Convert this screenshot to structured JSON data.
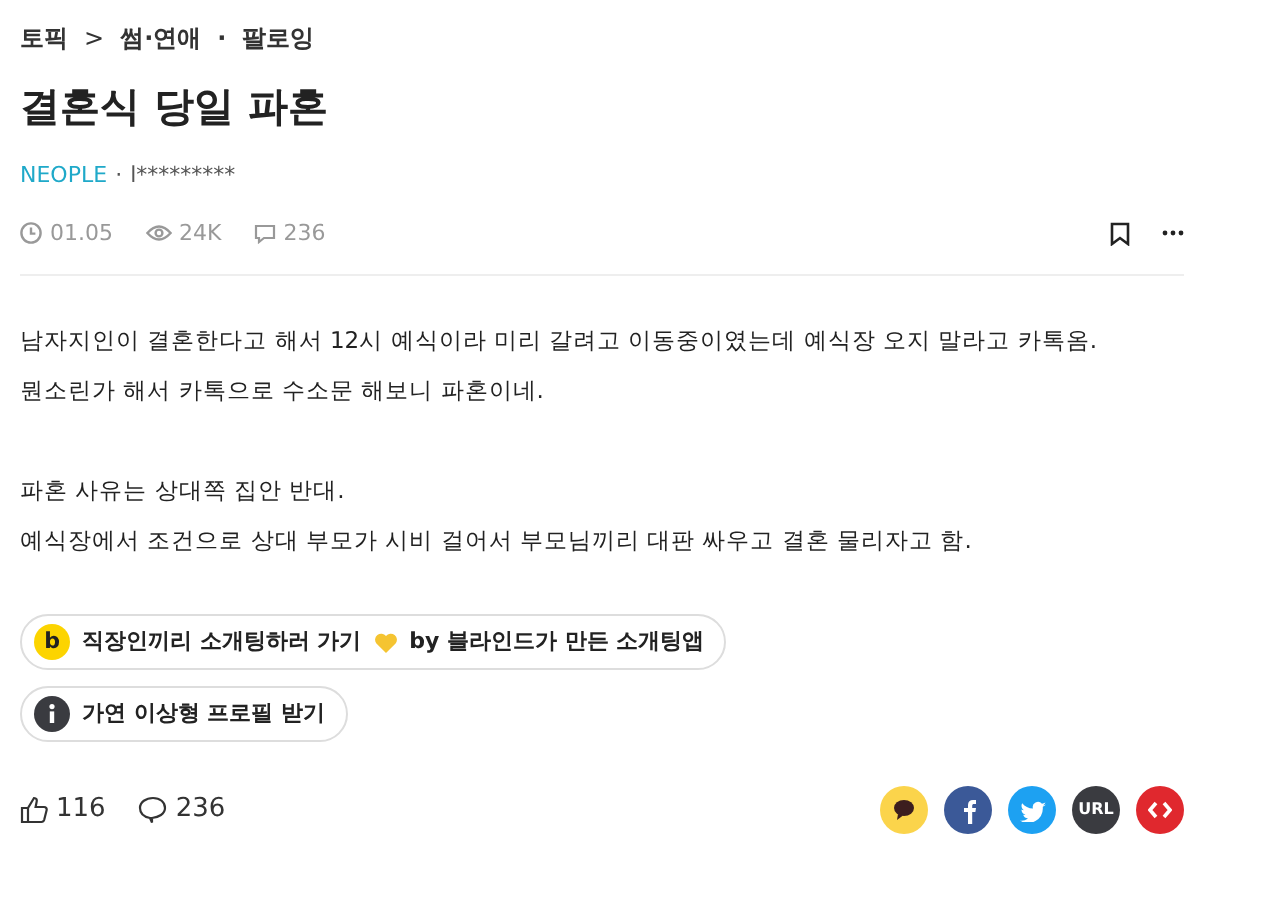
{
  "breadcrumb": {
    "topic": "토픽",
    "separator": ">",
    "category": "썸·연애",
    "dot": "·",
    "follow": "팔로잉"
  },
  "title": "결혼식 당일 파혼",
  "author": {
    "company": "NEOPLE",
    "separator": "·",
    "nickname": "l*********"
  },
  "meta": {
    "date": "01.05",
    "views": "24K",
    "comments": "236"
  },
  "body": [
    [
      "남자지인이 결혼한다고 해서 12시 예식이라 미리 갈려고 이동중이였는데 예식장 오지 말라고 카톡옴.",
      "뭔소린가 해서 카톡으로 수소문 해보니 파혼이네."
    ],
    [
      "파혼 사유는 상대쪽 집안 반대.",
      "예식장에서 조건으로 상대 부모가 시비 걸어서 부모님끼리 대판 싸우고 결혼 물리자고 함."
    ]
  ],
  "promos": [
    {
      "kind": "blind",
      "badge": "b",
      "text_before": "직장인끼리 소개팅하러 가기",
      "text_after": "by 블라인드가 만든 소개팅앱"
    },
    {
      "kind": "info",
      "text_before": "가연 이상형 프로필 받기"
    }
  ],
  "footer": {
    "likes": "116",
    "comments": "236"
  },
  "share": [
    {
      "kind": "kakao",
      "color": "#fbd44b"
    },
    {
      "kind": "facebook",
      "color": "#3b5998"
    },
    {
      "kind": "twitter",
      "color": "#1da1f2"
    },
    {
      "kind": "url",
      "color": "#3a3b40",
      "label": "URL"
    },
    {
      "kind": "embed",
      "color": "#e0282e"
    }
  ]
}
